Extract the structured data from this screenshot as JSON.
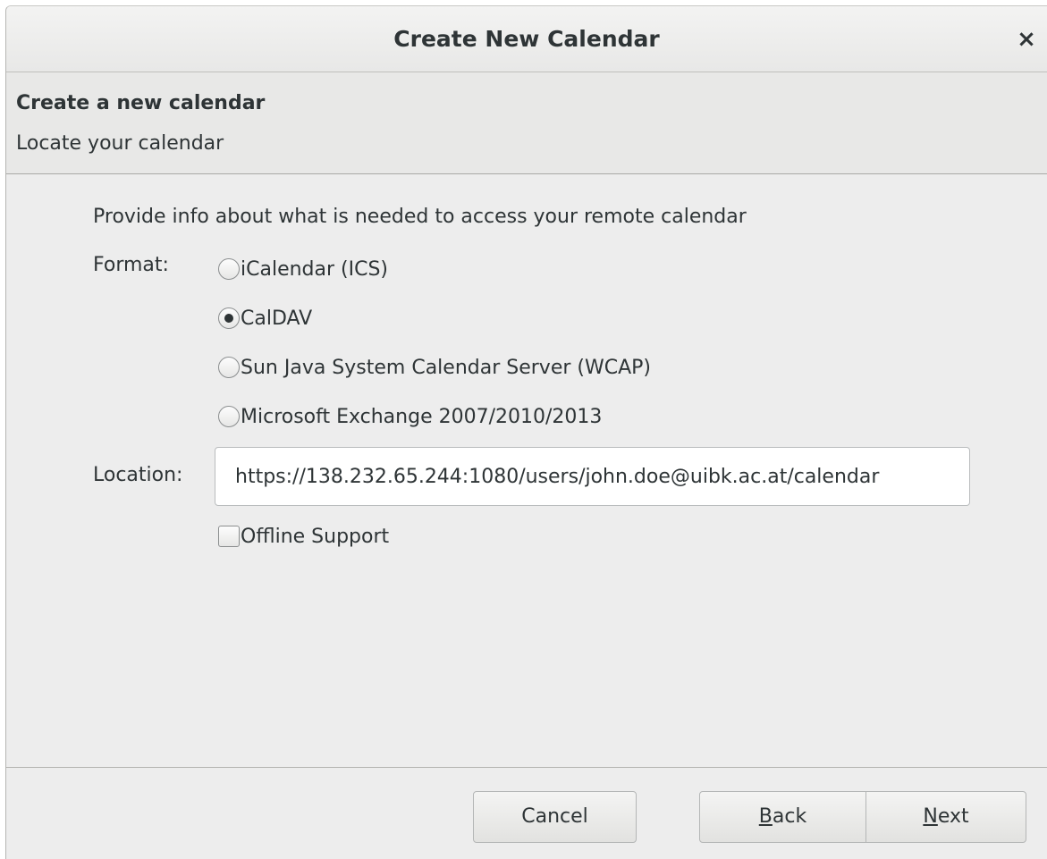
{
  "window": {
    "title": "Create New Calendar",
    "close_icon": "close-icon"
  },
  "header": {
    "title": "Create a new calendar",
    "subtitle": "Locate your calendar"
  },
  "form": {
    "intro": "Provide info about what is needed to access your remote calendar",
    "format_label": "Format:",
    "formats": [
      {
        "label": "iCalendar (ICS)",
        "checked": false
      },
      {
        "label": "CalDAV",
        "checked": true
      },
      {
        "label": "Sun Java System Calendar Server (WCAP)",
        "checked": false
      },
      {
        "label": "Microsoft Exchange 2007/2010/2013",
        "checked": false
      }
    ],
    "location_label": "Location:",
    "location_value": "https://138.232.65.244:1080/users/john.doe@uibk.ac.at/calendar",
    "offline_support_label": "Offline Support",
    "offline_support_checked": false
  },
  "buttons": {
    "cancel": "Cancel",
    "back_accel": "B",
    "back_rest": "ack",
    "next_accel": "N",
    "next_rest": "ext"
  }
}
